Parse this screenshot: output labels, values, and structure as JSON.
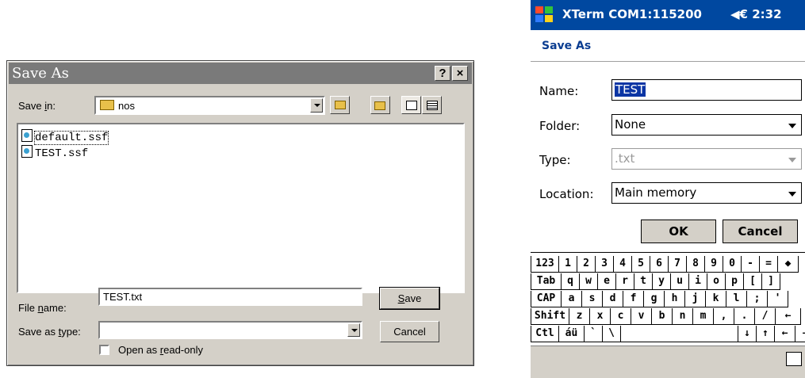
{
  "save_dialog": {
    "title": "Save As",
    "help_button": "?",
    "close_button": "×",
    "save_in": {
      "label_pre": "Save ",
      "label_hot": "i",
      "label_post": "n:",
      "value": "nos"
    },
    "files": [
      "default.ssf",
      "TEST.ssf"
    ],
    "file_name": {
      "label_pre": "File ",
      "label_hot": "n",
      "label_post": "ame:",
      "value": "TEST.txt"
    },
    "save_as_type": {
      "label_pre": "Save as ",
      "label_hot": "t",
      "label_post": "ype:",
      "value": ""
    },
    "save_button": {
      "hot": "S",
      "rest": "ave"
    },
    "cancel_button": "Cancel",
    "read_only": {
      "pre": "Open as ",
      "hot": "r",
      "post": "ead-only",
      "checked": false
    }
  },
  "ppc": {
    "title": "XTerm COM1:115200",
    "clock": "◀€ 2:32",
    "dialog_title": "Save As",
    "name_label": "Name:",
    "name_value": "TEST",
    "folder_label": "Folder:",
    "folder_value": "None",
    "type_label": "Type:",
    "type_value": ".txt",
    "location_label": "Location:",
    "location_value": "Main memory",
    "ok_button": "OK",
    "cancel_button": "Cancel",
    "keyboard": {
      "row1": [
        "123",
        "1",
        "2",
        "3",
        "4",
        "5",
        "6",
        "7",
        "8",
        "9",
        "0",
        "-",
        "=",
        "◆"
      ],
      "row2": [
        "Tab",
        "q",
        "w",
        "e",
        "r",
        "t",
        "y",
        "u",
        "i",
        "o",
        "p",
        "[",
        "]"
      ],
      "row3": [
        "CAP",
        "a",
        "s",
        "d",
        "f",
        "g",
        "h",
        "j",
        "k",
        "l",
        ";",
        "'"
      ],
      "row4": [
        "Shift",
        "z",
        "x",
        "c",
        "v",
        "b",
        "n",
        "m",
        ",",
        ".",
        "/",
        "←"
      ],
      "row5": [
        "Ctl",
        "áü",
        "`",
        "\\",
        "",
        "↓",
        "↑",
        "←",
        "→"
      ]
    }
  }
}
